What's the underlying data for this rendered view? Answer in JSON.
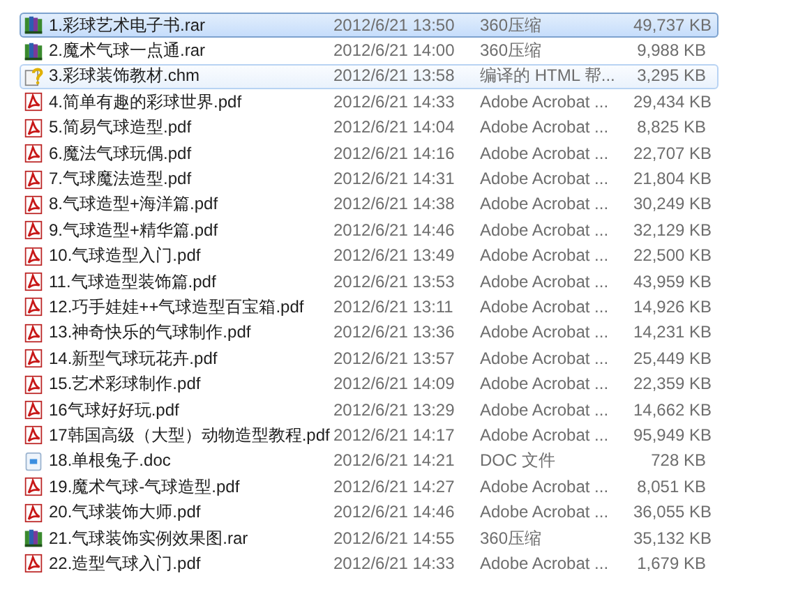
{
  "files": [
    {
      "kind": "rar",
      "name": "1.彩球艺术电子书.rar",
      "modified": "2012/6/21 13:50",
      "type": "360压缩",
      "size": "49,737 KB",
      "selected": true,
      "hot": false
    },
    {
      "kind": "rar",
      "name": "2.魔术气球一点通.rar",
      "modified": "2012/6/21 14:00",
      "type": "360压缩",
      "size": "9,988 KB",
      "selected": false,
      "hot": false
    },
    {
      "kind": "chm",
      "name": "3.彩球装饰教材.chm",
      "modified": "2012/6/21 13:58",
      "type": "编译的 HTML 帮...",
      "size": "3,295 KB",
      "selected": false,
      "hot": true
    },
    {
      "kind": "pdf",
      "name": "4.简单有趣的彩球世界.pdf",
      "modified": "2012/6/21 14:33",
      "type": "Adobe Acrobat ...",
      "size": "29,434 KB",
      "selected": false,
      "hot": false
    },
    {
      "kind": "pdf",
      "name": "5.简易气球造型.pdf",
      "modified": "2012/6/21 14:04",
      "type": "Adobe Acrobat ...",
      "size": "8,825 KB",
      "selected": false,
      "hot": false
    },
    {
      "kind": "pdf",
      "name": "6.魔法气球玩偶.pdf",
      "modified": "2012/6/21 14:16",
      "type": "Adobe Acrobat ...",
      "size": "22,707 KB",
      "selected": false,
      "hot": false
    },
    {
      "kind": "pdf",
      "name": "7.气球魔法造型.pdf",
      "modified": "2012/6/21 14:31",
      "type": "Adobe Acrobat ...",
      "size": "21,804 KB",
      "selected": false,
      "hot": false
    },
    {
      "kind": "pdf",
      "name": "8.气球造型+海洋篇.pdf",
      "modified": "2012/6/21 14:38",
      "type": "Adobe Acrobat ...",
      "size": "30,249 KB",
      "selected": false,
      "hot": false
    },
    {
      "kind": "pdf",
      "name": "9.气球造型+精华篇.pdf",
      "modified": "2012/6/21 14:46",
      "type": "Adobe Acrobat ...",
      "size": "32,129 KB",
      "selected": false,
      "hot": false
    },
    {
      "kind": "pdf",
      "name": "10.气球造型入门.pdf",
      "modified": "2012/6/21 13:49",
      "type": "Adobe Acrobat ...",
      "size": "22,500 KB",
      "selected": false,
      "hot": false
    },
    {
      "kind": "pdf",
      "name": "11.气球造型装饰篇.pdf",
      "modified": "2012/6/21 13:53",
      "type": "Adobe Acrobat ...",
      "size": "43,959 KB",
      "selected": false,
      "hot": false
    },
    {
      "kind": "pdf",
      "name": "12.巧手娃娃++气球造型百宝箱.pdf",
      "modified": "2012/6/21 13:11",
      "type": "Adobe Acrobat ...",
      "size": "14,926 KB",
      "selected": false,
      "hot": false
    },
    {
      "kind": "pdf",
      "name": "13.神奇快乐的气球制作.pdf",
      "modified": "2012/6/21 13:36",
      "type": "Adobe Acrobat ...",
      "size": "14,231 KB",
      "selected": false,
      "hot": false
    },
    {
      "kind": "pdf",
      "name": "14.新型气球玩花卉.pdf",
      "modified": "2012/6/21 13:57",
      "type": "Adobe Acrobat ...",
      "size": "25,449 KB",
      "selected": false,
      "hot": false
    },
    {
      "kind": "pdf",
      "name": "15.艺术彩球制作.pdf",
      "modified": "2012/6/21 14:09",
      "type": "Adobe Acrobat ...",
      "size": "22,359 KB",
      "selected": false,
      "hot": false
    },
    {
      "kind": "pdf",
      "name": "16气球好好玩.pdf",
      "modified": "2012/6/21 13:29",
      "type": "Adobe Acrobat ...",
      "size": "14,662 KB",
      "selected": false,
      "hot": false
    },
    {
      "kind": "pdf",
      "name": "17韩国高级（大型）动物造型教程.pdf",
      "modified": "2012/6/21 14:17",
      "type": "Adobe Acrobat ...",
      "size": "95,949 KB",
      "selected": false,
      "hot": false
    },
    {
      "kind": "doc",
      "name": "18.单根兔子.doc",
      "modified": "2012/6/21 14:21",
      "type": "DOC 文件",
      "size": "728 KB",
      "selected": false,
      "hot": false
    },
    {
      "kind": "pdf",
      "name": "19.魔术气球-气球造型.pdf",
      "modified": "2012/6/21 14:27",
      "type": "Adobe Acrobat ...",
      "size": "8,051 KB",
      "selected": false,
      "hot": false
    },
    {
      "kind": "pdf",
      "name": "20.气球装饰大师.pdf",
      "modified": "2012/6/21 14:46",
      "type": "Adobe Acrobat ...",
      "size": "36,055 KB",
      "selected": false,
      "hot": false
    },
    {
      "kind": "rar",
      "name": "21.气球装饰实例效果图.rar",
      "modified": "2012/6/21 14:55",
      "type": "360压缩",
      "size": "35,132 KB",
      "selected": false,
      "hot": false
    },
    {
      "kind": "pdf",
      "name": "22.造型气球入门.pdf",
      "modified": "2012/6/21 14:33",
      "type": "Adobe Acrobat ...",
      "size": "1,679 KB",
      "selected": false,
      "hot": false
    }
  ]
}
